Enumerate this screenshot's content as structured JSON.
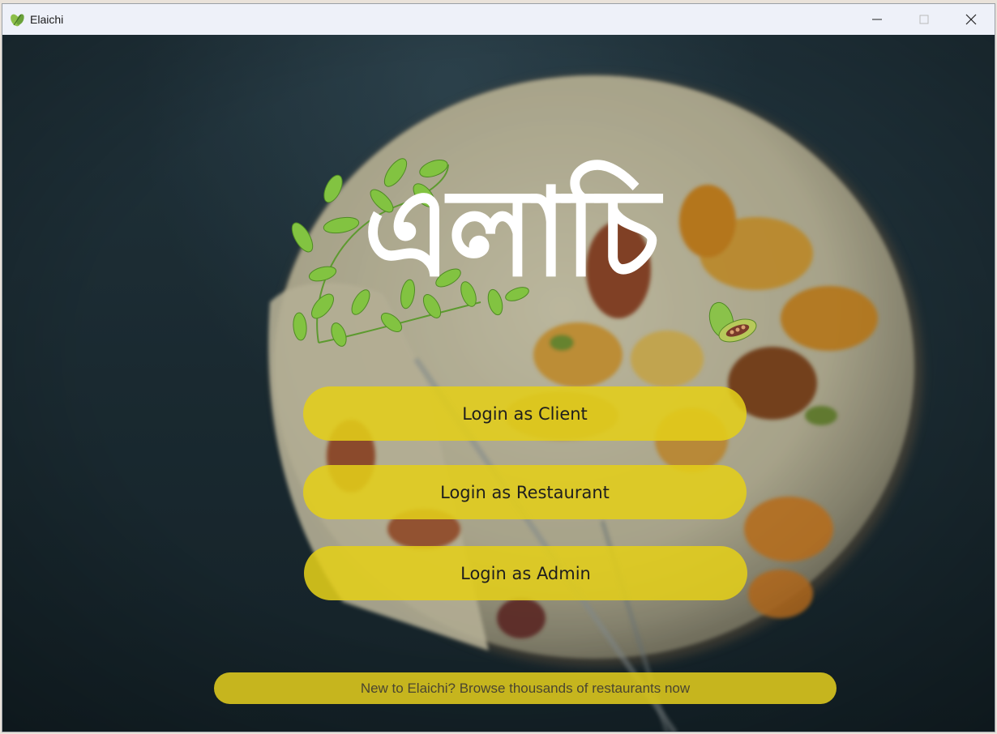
{
  "window": {
    "title": "Elaichi",
    "controls": [
      "minimize",
      "maximize",
      "close"
    ]
  },
  "logo": {
    "text": "এলাচি",
    "decoration": [
      "leaf-vine-icon",
      "cardamom-pod-icon"
    ]
  },
  "buttons": {
    "client": "Login as Client",
    "restaurant": "Login as Restaurant",
    "admin": "Login as Admin"
  },
  "browse": {
    "label": "New to Elaichi? Browse thousands of restaurants now"
  },
  "colors": {
    "button_bg": "#e2ce1a",
    "titlebar_bg": "#eef1f9",
    "background": "#1f2f36",
    "logo_text": "#ffffff",
    "leaf": "#7fbf3f"
  }
}
